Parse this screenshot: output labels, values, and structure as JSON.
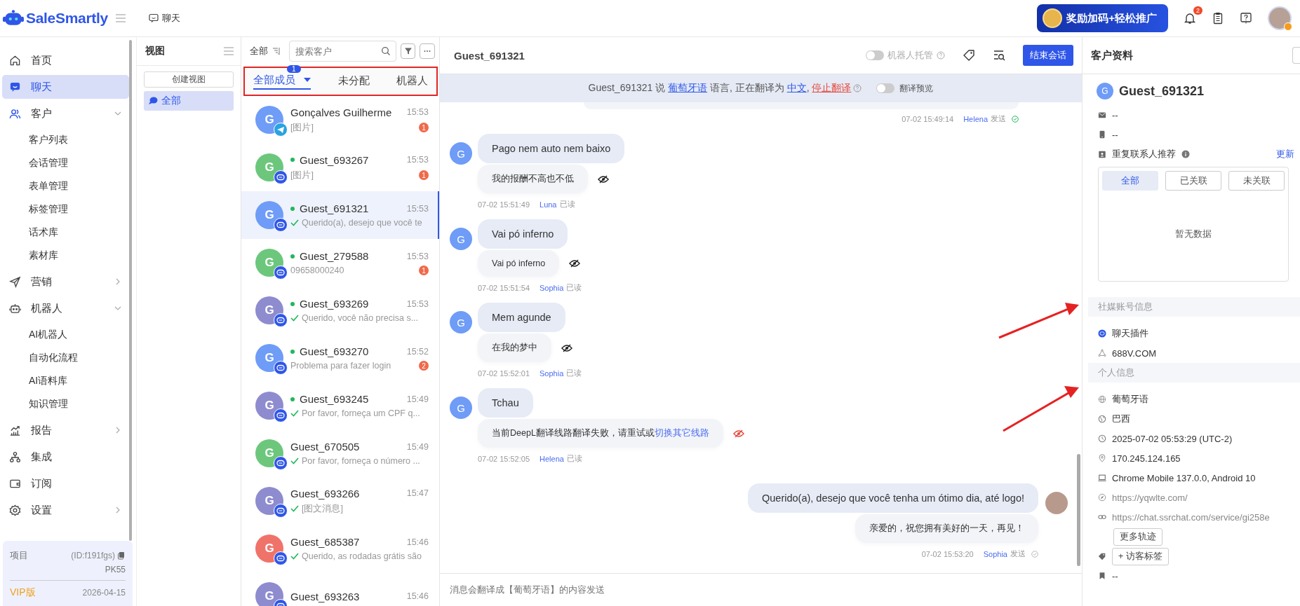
{
  "app": {
    "logo": "SaleSmartly",
    "page_tab": "聊天",
    "promo": "奖励加码+轻松推广",
    "notifications": "2"
  },
  "nav": [
    {
      "label": "首页",
      "selected": false
    },
    {
      "label": "聊天",
      "selected": true
    },
    {
      "label": "客户",
      "selected": false,
      "expanded": true,
      "children": [
        {
          "label": "客户列表"
        },
        {
          "label": "会话管理"
        },
        {
          "label": "表单管理"
        },
        {
          "label": "标签管理"
        },
        {
          "label": "话术库"
        },
        {
          "label": "素材库"
        }
      ]
    },
    {
      "label": "营销",
      "selected": false,
      "expanded": false
    },
    {
      "label": "机器人",
      "selected": false,
      "expanded": true,
      "children": [
        {
          "label": "AI机器人"
        },
        {
          "label": "自动化流程"
        },
        {
          "label": "AI语料库"
        },
        {
          "label": "知识管理"
        }
      ]
    },
    {
      "label": "报告",
      "selected": false,
      "expanded": false
    },
    {
      "label": "集成",
      "selected": false
    },
    {
      "label": "订阅",
      "selected": false
    },
    {
      "label": "设置",
      "selected": false,
      "expanded": false
    }
  ],
  "project": {
    "label": "项目",
    "id": "(ID:f191fgs)",
    "name": "PK55",
    "plan": "VIP版",
    "expires": "2026-04-15"
  },
  "views": {
    "title": "视图",
    "create": "创建视图",
    "items": [
      {
        "label": "全部",
        "selected": true
      }
    ]
  },
  "conversations": {
    "scope": "全部",
    "search_placeholder": "搜索客户",
    "tabs": [
      {
        "label": "全部成员",
        "selected": true,
        "badge": "1"
      },
      {
        "label": "未分配",
        "selected": false
      },
      {
        "label": "机器人",
        "selected": false
      }
    ],
    "items": [
      {
        "name": "Gonçalves Guilherme",
        "initial": "G",
        "time": "15:53",
        "preview": "[图片]",
        "online": false,
        "replied": false,
        "unread": "1",
        "kind": "telegram",
        "color": "#6e9cf7",
        "selected": false
      },
      {
        "name": "Guest_693267",
        "initial": "G",
        "time": "15:53",
        "preview": "[图片]",
        "online": true,
        "replied": false,
        "unread": "1",
        "kind": "chat",
        "color": "#6cc77c",
        "selected": false
      },
      {
        "name": "Guest_691321",
        "initial": "G",
        "time": "15:53",
        "preview": "Querido(a), desejo que você te",
        "online": true,
        "replied": true,
        "kind": "chat",
        "color": "#6e9cf7",
        "selected": true
      },
      {
        "name": "Guest_279588",
        "initial": "G",
        "time": "15:53",
        "preview": "09658000240",
        "online": true,
        "replied": false,
        "unread": "1",
        "kind": "chat",
        "color": "#6cc77c",
        "selected": false
      },
      {
        "name": "Guest_693269",
        "initial": "G",
        "time": "15:53",
        "preview": "Querido, você não precisa s...",
        "online": true,
        "replied": true,
        "kind": "chat",
        "color": "#8e8ccf",
        "selected": false
      },
      {
        "name": "Guest_693270",
        "initial": "G",
        "time": "15:52",
        "preview": "Problema para fazer login",
        "online": true,
        "replied": false,
        "unread": "2",
        "kind": "chat",
        "color": "#6e9cf7",
        "selected": false
      },
      {
        "name": "Guest_693245",
        "initial": "G",
        "time": "15:49",
        "preview": "Por favor, forneça um CPF q...",
        "online": true,
        "replied": true,
        "kind": "chat",
        "color": "#8e8ccf",
        "selected": false
      },
      {
        "name": "Guest_670505",
        "initial": "G",
        "time": "15:49",
        "preview": "Por favor, forneça o número ...",
        "online": false,
        "replied": true,
        "kind": "chat",
        "color": "#6cc77c",
        "selected": false
      },
      {
        "name": "Guest_693266",
        "initial": "G",
        "time": "15:47",
        "preview": "[图文消息]",
        "online": false,
        "replied": true,
        "kind": "chat",
        "color": "#8e8ccf",
        "selected": false
      },
      {
        "name": "Guest_685387",
        "initial": "G",
        "time": "15:46",
        "preview": "Querido, as rodadas grátis são",
        "online": false,
        "replied": true,
        "kind": "chat",
        "color": "#f0736a",
        "selected": false
      },
      {
        "name": "Guest_693263",
        "initial": "G",
        "time": "15:46",
        "online": false,
        "kind": "chat",
        "color": "#8e8ccf",
        "selected": false
      }
    ]
  },
  "chat": {
    "title": "Guest_691321",
    "bot_label": "机器人托管",
    "bot_on": false,
    "end_button": "结束会话",
    "translate_bar": {
      "lead": "Guest_691321 说 ",
      "source_language": "葡萄牙语",
      "middle": " 语言, 正在翻译为 ",
      "target_language": "中文",
      "separator": ", ",
      "stop": "停止翻译",
      "preview_label": "翻译预览",
      "preview_on": false
    },
    "messages": [
      {
        "kind": "clipped_out",
        "time": "07-02 15:49:14",
        "agent": "Helena",
        "status": "发送"
      },
      {
        "kind": "in",
        "initial": "G",
        "text": "Pago nem auto nem baixo",
        "translation": "我的报酬不高也不低",
        "time": "07-02 15:51:49",
        "agent": "Luna",
        "status": "已读"
      },
      {
        "kind": "in",
        "initial": "G",
        "text": "Vai pó inferno",
        "translation": "Vai pó inferno",
        "time": "07-02 15:51:54",
        "agent": "Sophia",
        "status": "已读"
      },
      {
        "kind": "in",
        "initial": "G",
        "text": "Mem agunde",
        "translation": "在我的梦中",
        "time": "07-02 15:52:01",
        "agent": "Sophia",
        "status": "已读"
      },
      {
        "kind": "in_failed",
        "initial": "G",
        "text": "Tchau",
        "translation": "当前DeepL翻译线路翻译失败，请重试或",
        "link": "切换其它线路",
        "time": "07-02 15:52:05",
        "agent": "Helena",
        "status": "已读"
      },
      {
        "kind": "out",
        "text": "Querido(a), desejo que você tenha um ótimo dia, até logo!",
        "translation": "亲爱的，祝您拥有美好的一天，再见！",
        "time": "07-02 15:53:20",
        "agent": "Sophia",
        "status": "发送"
      }
    ],
    "input_placeholder": "消息会翻译成【葡萄牙语】的内容发送"
  },
  "profile": {
    "title": "客户资料",
    "initial": "G",
    "name": "Guest_691321",
    "contacts": [
      {
        "kind": "email",
        "value": "--"
      },
      {
        "kind": "phone",
        "value": "--"
      }
    ],
    "duplicates": {
      "label": "重复联系人推荐",
      "refresh": "更新",
      "tabs": [
        {
          "label": "全部",
          "selected": true
        },
        {
          "label": "已关联",
          "selected": false
        },
        {
          "label": "未关联",
          "selected": false
        }
      ],
      "empty": "暂无数据"
    },
    "sections": [
      {
        "title": "社媒账号信息",
        "rows": [
          {
            "kind": "chat",
            "value": "聊天插件"
          },
          {
            "kind": "site",
            "value": "688V.COM"
          }
        ]
      },
      {
        "title": "个人信息",
        "rows": [
          {
            "kind": "language",
            "value": "葡萄牙语"
          },
          {
            "kind": "country",
            "value": "巴西"
          },
          {
            "kind": "time",
            "value": "2025-07-02 05:53:29 (UTC-2)"
          },
          {
            "kind": "ip",
            "value": "170.245.124.165"
          },
          {
            "kind": "device",
            "value": "Chrome Mobile 137.0.0, Android 10"
          },
          {
            "kind": "website",
            "value": "https://yqwlte.com/",
            "muted": true
          },
          {
            "kind": "link",
            "value": "https://chat.ssrchat.com/service/gi258e",
            "muted": true
          }
        ]
      }
    ],
    "more_button": "更多轨迹",
    "tag_button": "+ 访客标签",
    "note": "--"
  }
}
